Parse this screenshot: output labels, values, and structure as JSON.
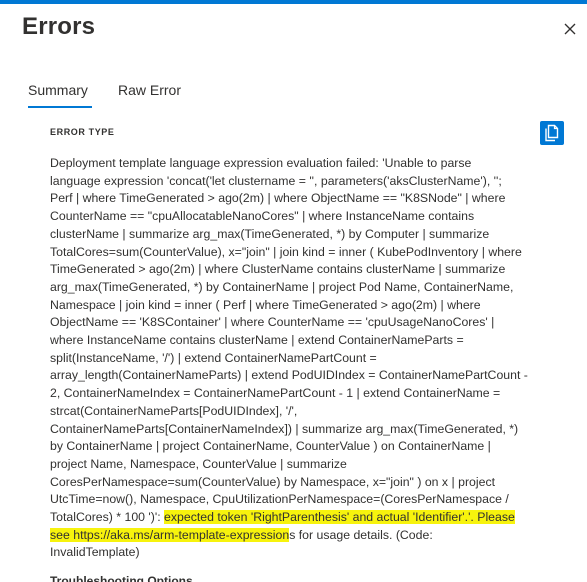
{
  "panel": {
    "title": "Errors",
    "accent_color": "#0078d4",
    "close_icon": "close-icon"
  },
  "tabs": [
    {
      "label": "Summary",
      "selected": true
    },
    {
      "label": "Raw Error",
      "selected": false
    }
  ],
  "error": {
    "type_label": "ERROR TYPE",
    "copy_icon": "copy-icon",
    "highlight_color": "#f7f30d",
    "lines": [
      "Deployment template language expression evaluation failed: 'Unable to parse",
      "language expression 'concat('let clustername = '', parameters('aksClusterName'), '';",
      "Perf | where TimeGenerated > ago(2m) | where ObjectName == \"K8SNode\" | where",
      "CounterName == \"cpuAllocatableNanoCores\" | where InstanceName contains",
      "clusterName | summarize arg_max(TimeGenerated, *) by Computer | summarize",
      "TotalCores=sum(CounterValue), x=\"join\" | join kind = inner ( KubePodInventory | where",
      "TimeGenerated > ago(2m) | where ClusterName contains clusterName | summarize",
      "arg_max(TimeGenerated, *) by ContainerName | project Pod Name, ContainerName,",
      "Namespace | join kind = inner ( Perf | where TimeGenerated > ago(2m) | where",
      "ObjectName == 'K8SContainer' | where CounterName == 'cpuUsageNanoCores' |",
      "where InstanceName contains clusterName | extend ContainerNameParts =",
      "split(InstanceName, '/') | extend ContainerNamePartCount =",
      "array_length(ContainerNameParts) | extend PodUIDIndex = ContainerNamePartCount -",
      "2, ContainerNameIndex = ContainerNamePartCount - 1 | extend ContainerName =",
      "strcat(ContainerNameParts[PodUIDIndex], '/',",
      "ContainerNameParts[ContainerNameIndex]) | summarize arg_max(TimeGenerated, *)",
      "by ContainerName | project ContainerName, CounterValue ) on ContainerName |",
      "project Name, Namespace, CounterValue | summarize",
      "CoresPerNamespace=sum(CounterValue) by Namespace, x=\"join\" ) on x | project",
      "UtcTime=now(), Namespace, CpuUtilizationPerNamespace=(CoresPerNamespace /"
    ],
    "line21_plain": "TotalCores) * 100 ')': ",
    "line21_highlight": "expected token 'RightParenthesis' and actual 'Identifier'.'. Please",
    "line22_highlight": "see https://aka.ms/arm-template-expression",
    "line22_plain": "s for usage details. (Code:",
    "line23": "InvalidTemplate)"
  },
  "troubleshooting": {
    "heading": "Troubleshooting Options"
  }
}
